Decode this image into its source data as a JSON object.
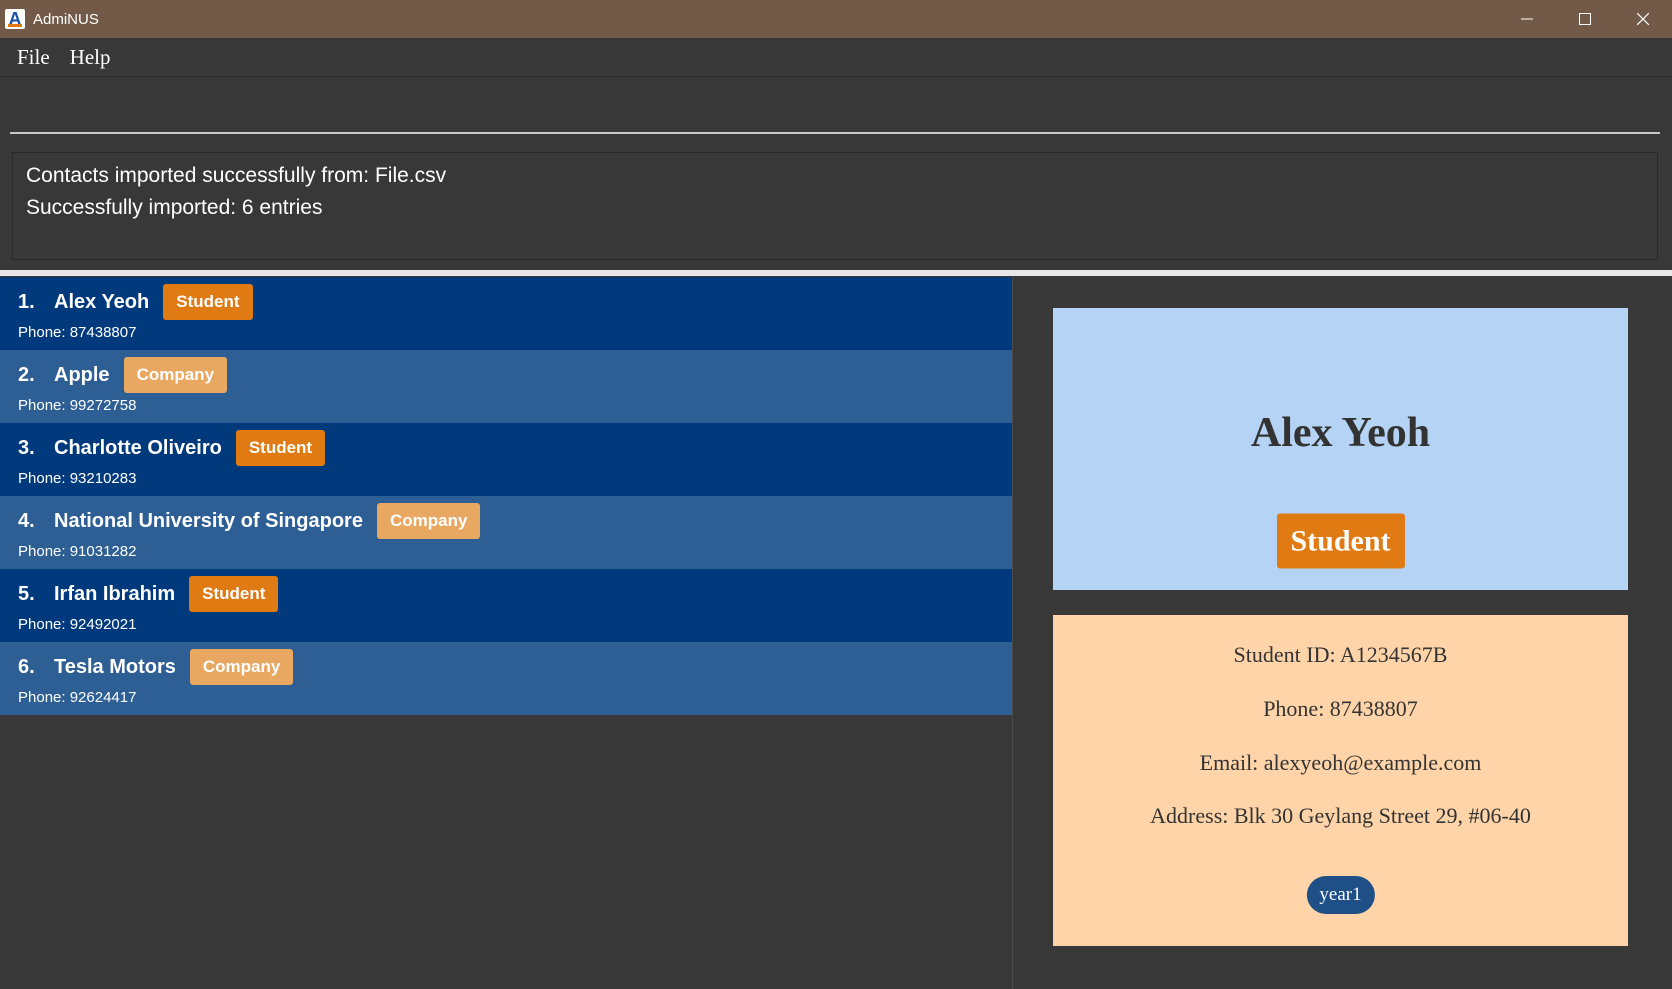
{
  "window": {
    "title": "AdmiNUS",
    "icon": "app-logo-icon",
    "controls": [
      "minimize-icon",
      "maximize-icon",
      "close-icon"
    ]
  },
  "menu": {
    "items": [
      "File",
      "Help"
    ]
  },
  "command": {
    "value": "",
    "placeholder": ""
  },
  "result": {
    "line1": "Contacts imported successfully from: File.csv",
    "line2": "Successfully imported: 6 entries"
  },
  "contacts": [
    {
      "index": "1.",
      "name": "Alex Yeoh",
      "type": "Student",
      "phone": "Phone: 87438807"
    },
    {
      "index": "2.",
      "name": "Apple",
      "type": "Company",
      "phone": "Phone: 99272758"
    },
    {
      "index": "3.",
      "name": "Charlotte Oliveiro",
      "type": "Student",
      "phone": "Phone: 93210283"
    },
    {
      "index": "4.",
      "name": "National University of Singapore",
      "type": "Company",
      "phone": "Phone: 91031282"
    },
    {
      "index": "5.",
      "name": "Irfan Ibrahim",
      "type": "Student",
      "phone": "Phone: 92492021"
    },
    {
      "index": "6.",
      "name": "Tesla Motors",
      "type": "Company",
      "phone": "Phone: 92624417"
    }
  ],
  "detail": {
    "name": "Alex Yeoh",
    "type": "Student",
    "student_id": "Student ID: A1234567B",
    "phone": "Phone: 87438807",
    "email": "Email: alexyeoh@example.com",
    "address": "Address: Blk 30 Geylang Street 29, #06-40",
    "tag": "year1"
  },
  "colors": {
    "titlebar": "#735a48",
    "background": "#383838",
    "row_odd": "#003a7c",
    "row_even": "#2e5f94",
    "student_tag": "#e07a12",
    "company_tag": "#e8a862",
    "detail_header": "#b5d3f5",
    "detail_info": "#fed4a8",
    "detail_tag": "#1e4f86"
  }
}
